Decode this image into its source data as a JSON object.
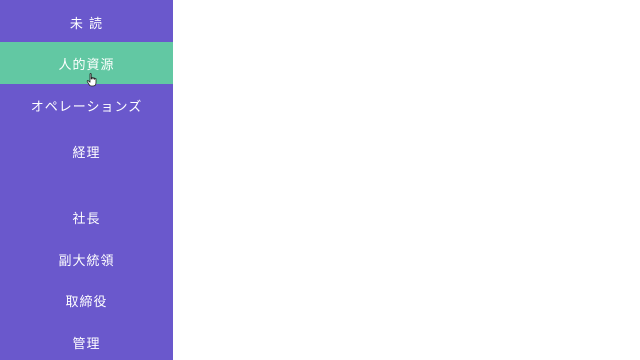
{
  "sidebar": {
    "background": "#6a58cc",
    "active_color": "#62c8a3",
    "items": [
      {
        "label": "未 読",
        "active": false
      },
      {
        "label": "人的資源",
        "active": true
      },
      {
        "label": "オペレーションズ",
        "active": false
      },
      {
        "label": "経理",
        "active": false
      },
      {
        "label": "社長",
        "active": false
      },
      {
        "label": "副大統領",
        "active": false
      },
      {
        "label": "取締役",
        "active": false
      },
      {
        "label": "管理",
        "active": false
      }
    ]
  },
  "cursor": {
    "icon": "hand-pointer-icon"
  }
}
